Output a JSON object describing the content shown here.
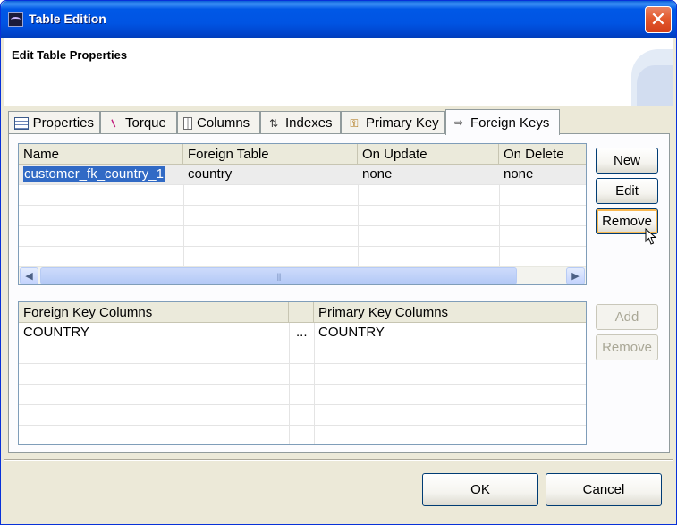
{
  "window": {
    "title": "Table Edition",
    "close_glyph": "✕"
  },
  "header": {
    "title": "Edit Table Properties"
  },
  "tabs": [
    {
      "label": "Properties",
      "icon": "table-properties-icon"
    },
    {
      "label": "Torque",
      "icon": "torque-icon"
    },
    {
      "label": "Columns",
      "icon": "columns-icon"
    },
    {
      "label": "Indexes",
      "icon": "indexes-icon"
    },
    {
      "label": "Primary Key",
      "icon": "primary-key-icon"
    },
    {
      "label": "Foreign Keys",
      "icon": "foreign-keys-icon",
      "active": true
    }
  ],
  "fk_table": {
    "columns": [
      "Name",
      "Foreign Table",
      "On Update",
      "On Delete"
    ],
    "rows": [
      {
        "name": "customer_fk_country_1",
        "foreign_table": "country",
        "on_update": "none",
        "on_delete": "none"
      }
    ],
    "scroll_thumb_glyph": "|||"
  },
  "fk_buttons": {
    "new_label": "New",
    "edit_label": "Edit",
    "remove_label": "Remove"
  },
  "col_table": {
    "columns": [
      "Foreign Key Columns",
      "",
      "Primary Key Columns"
    ],
    "rows": [
      {
        "fk_column": "COUNTRY",
        "link": "...",
        "pk_column": "COUNTRY"
      }
    ]
  },
  "col_buttons": {
    "add_label": "Add",
    "remove_label": "Remove"
  },
  "dialog_buttons": {
    "ok_label": "OK",
    "cancel_label": "Cancel"
  },
  "colors": {
    "titlebar": "#0054e3",
    "selection": "#316ac5",
    "dialog_bg": "#ece9d8"
  }
}
